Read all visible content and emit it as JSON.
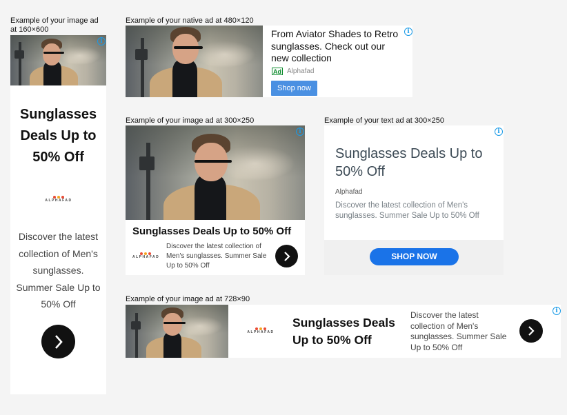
{
  "ad160x600": {
    "caption": "Example of your image ad at 160×600",
    "headline": "Sunglasses Deals Up to 50% Off",
    "logo_text": "ALPHAFAD",
    "description": "Discover the latest collection of Men's sunglasses. Summer Sale Up to 50% Off",
    "info_glyph": "i",
    "arrow_icon": "chevron-right-icon"
  },
  "native480x120": {
    "caption": "Example of your native ad at 480×120",
    "headline": "From Aviator Shades to Retro sunglasses. Check out our new collection",
    "ad_badge": "Ad",
    "advertiser": "Alphafad",
    "cta": "Shop now",
    "info_glyph": "i"
  },
  "image300x250": {
    "caption": "Example of your image ad at 300×250",
    "headline": "Sunglasses Deals Up to 50% Off",
    "logo_text": "ALPHAFAD",
    "description": "Discover the latest collection of Men's sunglasses. Summer Sale Up to 50% Off",
    "info_glyph": "i"
  },
  "text300x250": {
    "caption": "Example of your text ad at 300×250",
    "headline": "Sunglasses Deals Up to 50% Off",
    "advertiser": "Alphafad",
    "description": "Discover the latest collection of Men's sunglasses. Summer Sale Up to 50% Off",
    "cta": "SHOP NOW",
    "info_glyph": "i"
  },
  "image728x90": {
    "caption": "Example of your image ad at 728×90",
    "headline": "Sunglasses Deals Up to 50% Off",
    "logo_text": "ALPHAFAD",
    "description": "Discover the latest collection of Men's sunglasses. Summer Sale Up to 50% Off",
    "info_glyph": "i"
  },
  "colors": {
    "page_bg": "#f4f4f4",
    "info_blue": "#1a9be8",
    "native_cta": "#4a90e2",
    "text_cta": "#1a73e8",
    "ad_badge_green": "#0a8a2a",
    "logo_dots": [
      "#e94b35",
      "#f5a623",
      "#e94b35"
    ]
  }
}
